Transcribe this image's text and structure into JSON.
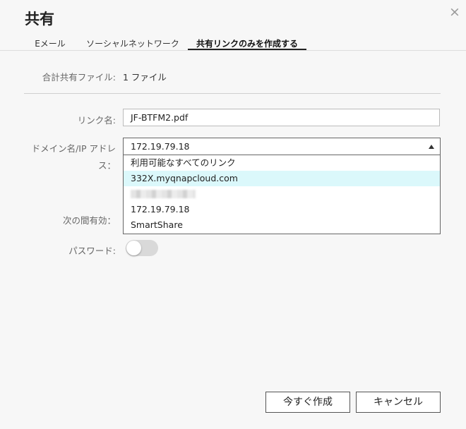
{
  "dialog": {
    "title": "共有",
    "close_icon": "×"
  },
  "tabs": [
    {
      "label": "Eメール"
    },
    {
      "label": "ソーシャルネットワーク"
    },
    {
      "label": "共有リンクのみを作成する",
      "active": true
    }
  ],
  "form": {
    "total_files_label": "合計共有ファイル:",
    "total_files_value": "1 ファイル",
    "link_name_label": "リンク名:",
    "link_name_value": "JF-BTFM2.pdf",
    "domain_label_line1": "ドメイン名/IP アドレ",
    "domain_label_line2": "ス：",
    "domain_selected": "172.19.79.18",
    "domain_options": [
      {
        "label": "利用可能なすべてのリンク"
      },
      {
        "label": "332X.myqnapcloud.com",
        "highlighted": true
      },
      {
        "label": "",
        "redacted": true
      },
      {
        "label": "172.19.79.18"
      },
      {
        "label": "SmartShare"
      }
    ],
    "valid_until_label": "次の間有効：",
    "password_label": "パスワード:",
    "password_enabled": false
  },
  "buttons": {
    "create_now": "今すぐ作成",
    "cancel": "キャンセル"
  },
  "colors": {
    "highlight": "#dbf8fb",
    "toggle_off": "#d9d9d9"
  }
}
